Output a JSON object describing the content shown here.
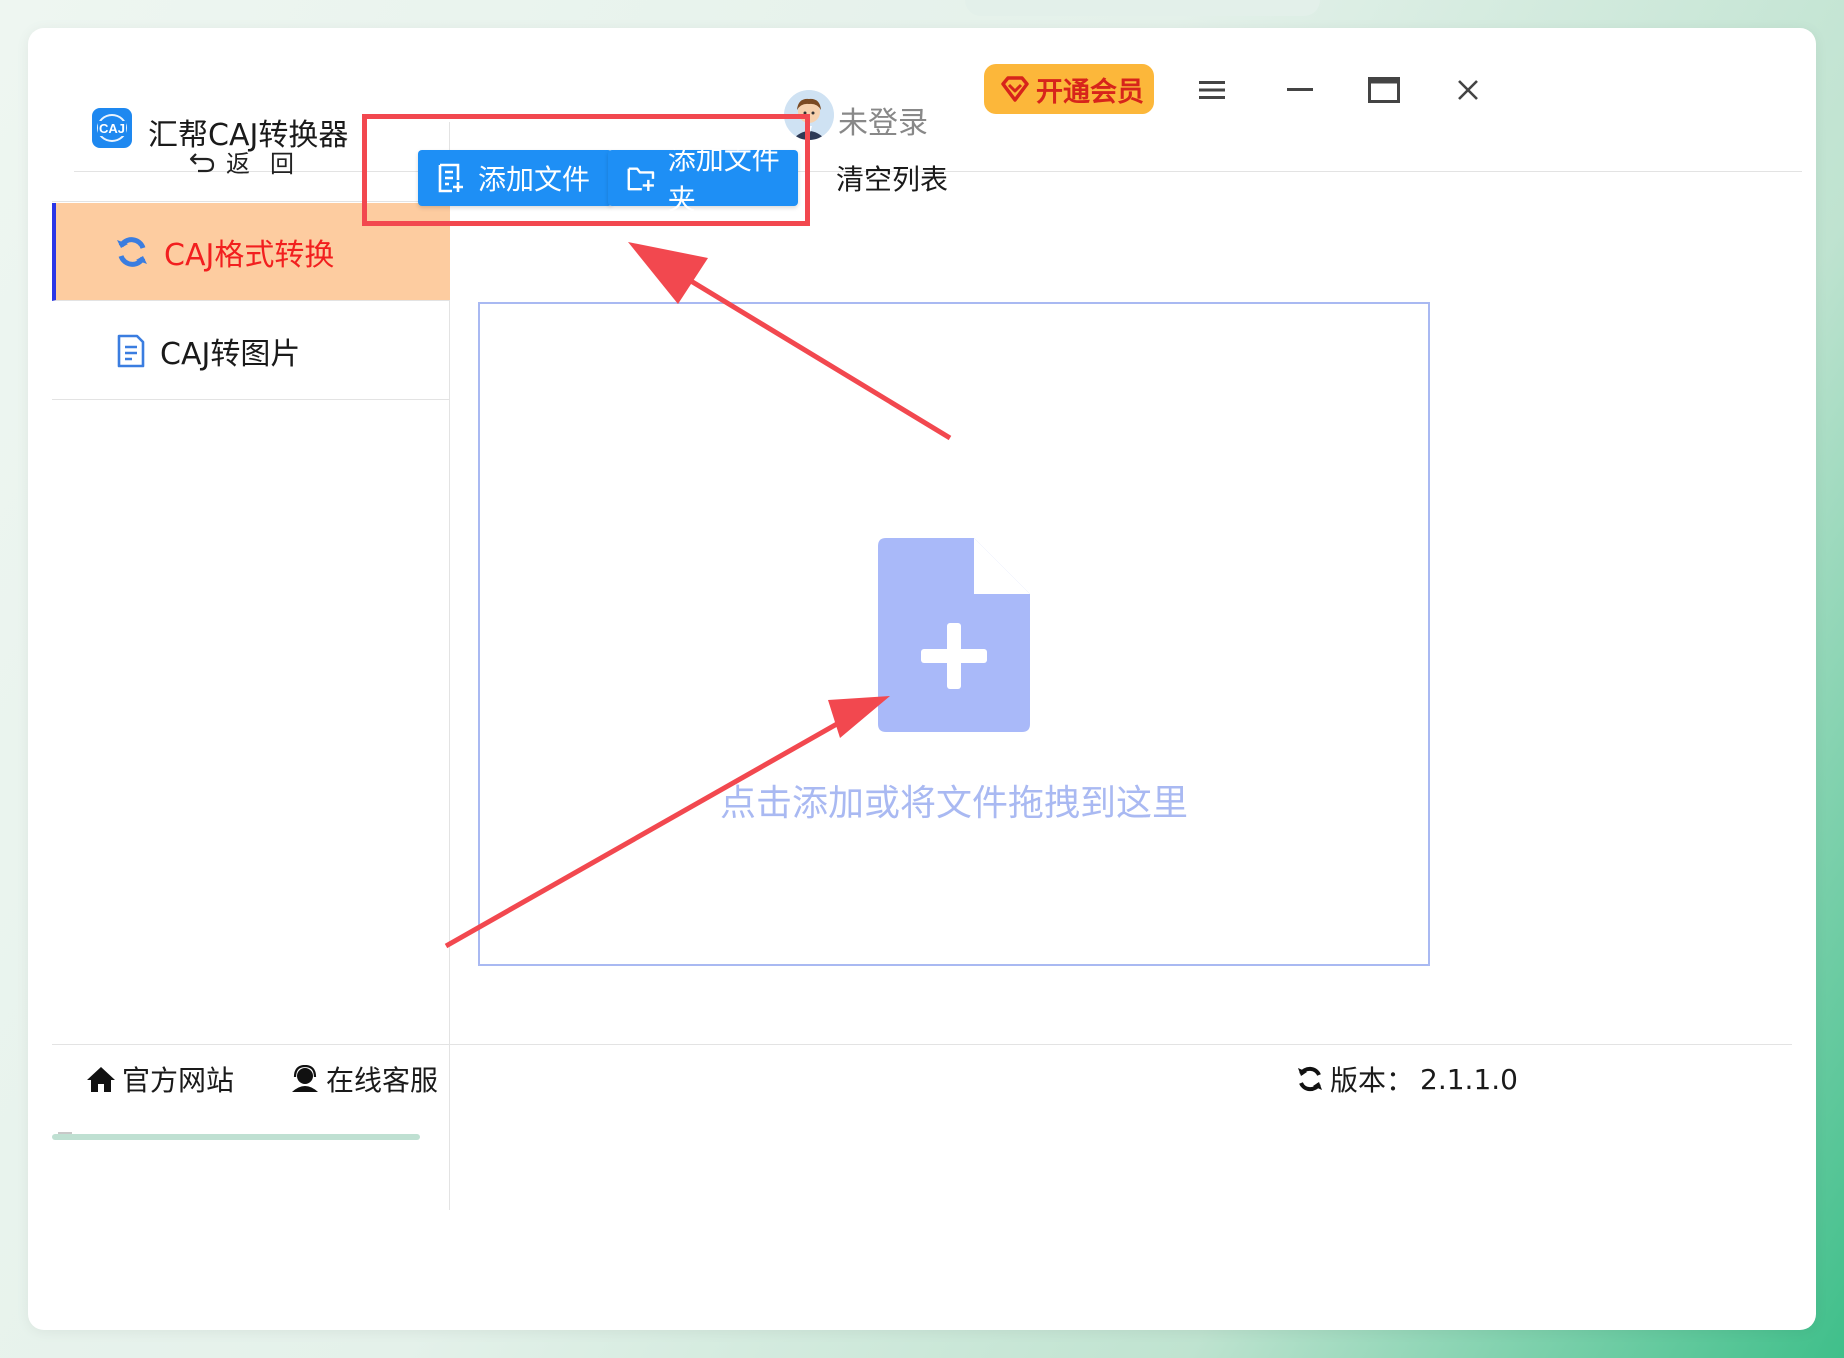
{
  "app": {
    "title": "汇帮CAJ转换器",
    "logo_text": "CAJ"
  },
  "header": {
    "login_status": "未登录",
    "vip_label": "开通会员",
    "icons": [
      "user-avatar",
      "diamond-icon",
      "menu-icon",
      "minimize-icon",
      "maximize-icon",
      "close-icon"
    ]
  },
  "sidebar": {
    "back_label": "返回",
    "items": [
      {
        "label": "CAJ格式转换",
        "icon": "refresh-icon",
        "active": true
      },
      {
        "label": "CAJ转图片",
        "icon": "document-icon",
        "active": false
      }
    ]
  },
  "toolbar": {
    "add_file": "添加文件",
    "add_folder": "添加文件夹",
    "clear_list": "清空列表"
  },
  "dropzone": {
    "hint": "点击添加或将文件拖拽到这里"
  },
  "footer": {
    "website": "官方网站",
    "service": "在线客服",
    "version_label": "版本：",
    "version": "2.1.1.0"
  },
  "colors": {
    "accent_blue": "#1e8ff5",
    "active_nav_bg": "#fdcca0",
    "active_nav_text": "#f21f1f",
    "vip_bg": "#fcb73a",
    "annotation_red": "#f2484f",
    "dropzone_tint": "#a9b9f2"
  }
}
